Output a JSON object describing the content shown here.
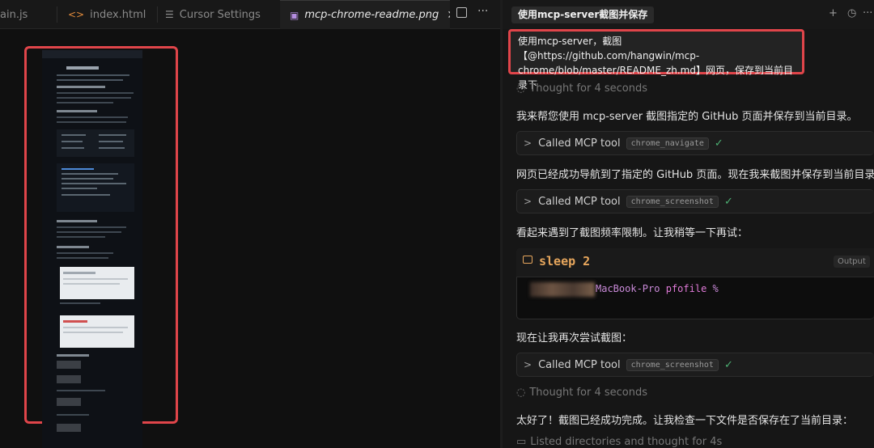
{
  "tabs": [
    {
      "label": "ain.js",
      "icon": "js-icon"
    },
    {
      "label": "index.html",
      "icon": "code-icon"
    },
    {
      "label": "Cursor Settings",
      "icon": "gear-icon"
    },
    {
      "label": "mcp-chrome-readme.png",
      "icon": "image-icon"
    }
  ],
  "chat": {
    "title": "使用mcp-server截图并保存",
    "user_message": "使用mcp-server，截图【@https://github.com/hangwin/mcp-chrome/blob/master/README_zh.md】网页，保存到当前目录下",
    "thought_1": "Thought for 4 seconds",
    "para_1": "我来帮您使用 mcp-server 截图指定的 GitHub 页面并保存到当前目录。",
    "tool_1": {
      "label": "Called MCP tool",
      "name": "chrome_navigate"
    },
    "para_2": "网页已经成功导航到了指定的 GitHub 页面。现在我来截图并保存到当前目录：",
    "tool_2": {
      "label": "Called MCP tool",
      "name": "chrome_screenshot"
    },
    "para_3": "看起来遇到了截图频率限制。让我稍等一下再试：",
    "terminal": {
      "command": "sleep 2",
      "badge": "Output",
      "prompt": "MacBook-Pro",
      "dir": "pfofile",
      "symbol": "%"
    },
    "para_4": "现在让我再次尝试截图：",
    "tool_3": {
      "label": "Called MCP tool",
      "name": "chrome_screenshot"
    },
    "thought_2": "Thought for 4 seconds",
    "para_5": "太好了！截图已经成功完成。让我检查一下文件是否保存在了当前目录：",
    "listed": "Listed directories and thought for 4s"
  },
  "colors": {
    "highlight": "#e0454a",
    "success": "#4caf72",
    "command": "#e8a75d"
  }
}
